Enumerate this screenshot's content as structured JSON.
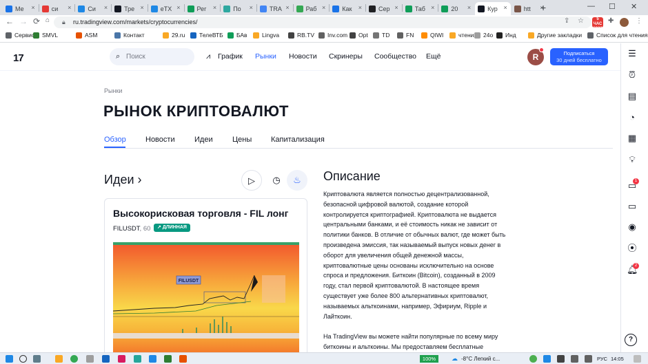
{
  "browser": {
    "tabs": [
      {
        "label": "Ме",
        "color": "#1a73e8"
      },
      {
        "label": "си",
        "color": "#e53935"
      },
      {
        "label": "Си",
        "color": "#1e88e5"
      },
      {
        "label": "Тре",
        "color": "#131722"
      },
      {
        "label": "eTX",
        "color": "#1e88e5"
      },
      {
        "label": "Рег",
        "color": "#0f9d58"
      },
      {
        "label": "По",
        "color": "#2ea8a0"
      },
      {
        "label": "TRA",
        "color": "#4285f4"
      },
      {
        "label": "Раб",
        "color": "#34a853"
      },
      {
        "label": "Как",
        "color": "#1a73e8"
      },
      {
        "label": "Сер",
        "color": "#202124"
      },
      {
        "label": "Таб",
        "color": "#0f9d58"
      },
      {
        "label": "20",
        "color": "#0f9d58"
      },
      {
        "label": "Кур",
        "color": "#131722",
        "active": true
      },
      {
        "label": "htt",
        "color": "#795548"
      }
    ],
    "url": "ru.tradingview.com/markets/cryptocurrencies/",
    "news_badge": "5 ЧАС 6823",
    "bookmarks": [
      {
        "label": "Сервисы",
        "color": "#5f6368"
      },
      {
        "label": "SMVL",
        "color": "#2e7d32"
      },
      {
        "label": "ASM",
        "color": "#e65100"
      },
      {
        "label": "Контакт",
        "color": "#4a76a8"
      },
      {
        "label": "29.ru",
        "color": "#f9a825"
      },
      {
        "label": "ТелеВТБ",
        "color": "#1565c0"
      },
      {
        "label": "БАв",
        "color": "#0f9d58"
      },
      {
        "label": "Lingva",
        "color": "#f9a825"
      },
      {
        "label": "RB.TV",
        "color": "#424242"
      },
      {
        "label": "Inv.com",
        "color": "#616161"
      },
      {
        "label": "Opt",
        "color": "#424242"
      },
      {
        "label": "TD",
        "color": "#757575"
      },
      {
        "label": "FN",
        "color": "#616161"
      },
      {
        "label": "QIWI",
        "color": "#ff8c00"
      },
      {
        "label": "чтения",
        "color": "#f9a825"
      },
      {
        "label": "24o",
        "color": "#9e9e9e"
      },
      {
        "label": "Инд",
        "color": "#212121"
      },
      {
        "label": "Другие закладки",
        "color": "#f9a825"
      },
      {
        "label": "Список для чтения",
        "color": "#5f6368"
      }
    ]
  },
  "header": {
    "logo": "17",
    "search_placeholder": "Поиск",
    "nav": [
      {
        "label": "График",
        "active": false
      },
      {
        "label": "Рынки",
        "active": true
      },
      {
        "label": "Новости",
        "active": false
      },
      {
        "label": "Скринеры",
        "active": false
      },
      {
        "label": "Сообщество",
        "active": false
      },
      {
        "label": "Ещё",
        "active": false
      }
    ],
    "avatar_letter": "R",
    "subscribe_line1": "Подписаться",
    "subscribe_line2": "30 дней бесплатно"
  },
  "rail": {
    "badge_chat": "1",
    "badge_alerts": "2"
  },
  "page": {
    "breadcrumb": "Рынки",
    "title": "РЫНОК КРИПТОВАЛЮТ",
    "subtabs": [
      "Обзор",
      "Новости",
      "Идеи",
      "Цены",
      "Капитализация"
    ]
  },
  "ideas": {
    "title": "Идеи ›",
    "card": {
      "title": "Высокорисковая торговля - FIL лонг",
      "symbol": "FILUSDT",
      "timeframe": ", 60",
      "direction": "↗ ДЛИННАЯ",
      "chart_label": "FILUSDT"
    }
  },
  "description": {
    "title": "Описание",
    "paragraphs": [
      "Криптовалюта является полностью децентрализованной, безопасной цифровой валютой, создание которой контролируется криптографией. Криптовалюта не выдается центральными банками, и её стоимость никак не зависит от политики банков. В отличие от обычных валют, где может быть произведена эмиссия, так называемый выпуск новых денег в оборот для увеличения общей денежной массы, криптовалютные цены основаны исключительно на основе спроса и предложения. Биткоин (Bitcoin), созданный в 2009 году, стал первой криптовалютой. В настоящее время существует уже более 800 альтернативных криптовалют, называемых альткоинами, например, Эфириум, Ripple и Лайткоин.",
      "На TradingView вы можете найти популярные по всему миру биткоины и альткоины. Мы предоставляем бесплатные"
    ]
  },
  "taskbar": {
    "battery": "100%",
    "weather": "-8°C Легкий с...",
    "lang": "РУС",
    "time": "14:05"
  }
}
